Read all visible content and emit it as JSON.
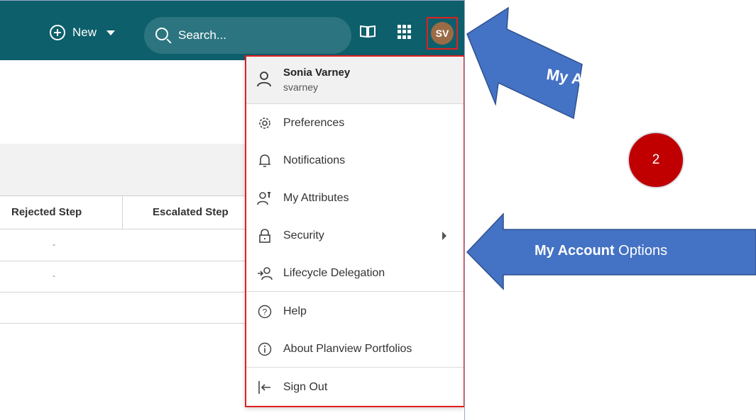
{
  "header": {
    "new_label": "New",
    "search_placeholder": "Search...",
    "avatar_initials": "SV"
  },
  "table": {
    "columns": [
      "Rejected Step",
      "Escalated Step"
    ],
    "rows": [
      {
        "rejected_step": "-"
      },
      {
        "rejected_step": "-"
      }
    ]
  },
  "account_menu": {
    "user_name": "Sonia Varney",
    "user_login": "svarney",
    "items": [
      {
        "label": "Preferences",
        "icon": "gear-icon"
      },
      {
        "label": "Notifications",
        "icon": "bell-icon"
      },
      {
        "label": "My Attributes",
        "icon": "user-attributes-icon"
      },
      {
        "label": "Security",
        "icon": "lock-icon",
        "has_submenu": true
      },
      {
        "label": "Lifecycle Delegation",
        "icon": "delegation-icon"
      },
      {
        "label": "Help",
        "icon": "help-icon"
      },
      {
        "label": "About Planview Portfolios",
        "icon": "info-icon"
      },
      {
        "label": "Sign Out",
        "icon": "sign-out-icon"
      }
    ]
  },
  "annotations": {
    "my_account": "My Account",
    "options_bold": "My Account",
    "options_rest": " Options",
    "step_badge": "2"
  },
  "colors": {
    "topbar": "#0d5f6b",
    "annotation_arrow": "#4472c4",
    "highlight": "#e02020",
    "badge": "#c00000"
  }
}
